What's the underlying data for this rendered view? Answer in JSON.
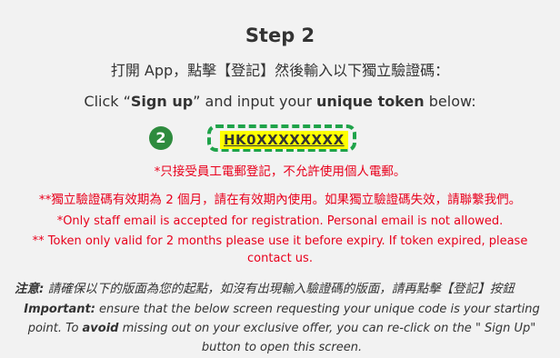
{
  "step": {
    "title": "Step 2",
    "instruction_zh": "打開 App，點擊【登記】然後輸入以下獨立驗證碼：",
    "instruction_en": {
      "p1": "Click “",
      "sign_up": "Sign up",
      "p2": "” and input your ",
      "unique_token": "unique token",
      "p3": " below:"
    }
  },
  "token": {
    "badge": "2",
    "value": "HK0XXXXXXXX"
  },
  "warnings": {
    "zh_staff_only": "*只接受員工電郵登記，不允許使用個人電郵。",
    "zh_validity": "**獨立驗證碼有效期為 2 個月，請在有效期內使用。如果獨立驗證碼失效，請聯繫我們。",
    "en_staff_only": "*Only staff email is accepted for registration. Personal email is not allowed.",
    "en_validity": "** Token only valid for 2 months please use it before expiry. If token expired, please contact us."
  },
  "notes": {
    "zh_label": "注意:",
    "zh_text": " 請確保以下的版面為您的起點，如沒有出現輸入驗證碼的版面，請再點擊【登記】按鈕",
    "en_label": "Important:",
    "en_p1": " ensure that the below screen requesting your unique code is your starting point. To ",
    "en_avoid": "avoid",
    "en_p2": " missing out on your exclusive offer, you can re-click on the \" Sign Up\" button to open this screen."
  },
  "colors": {
    "background": "#f2f2f2",
    "warning_red": "#e8001c",
    "badge_green": "#2e8b3e",
    "frame_green": "#1fa34a",
    "token_highlight": "#ffff00"
  }
}
